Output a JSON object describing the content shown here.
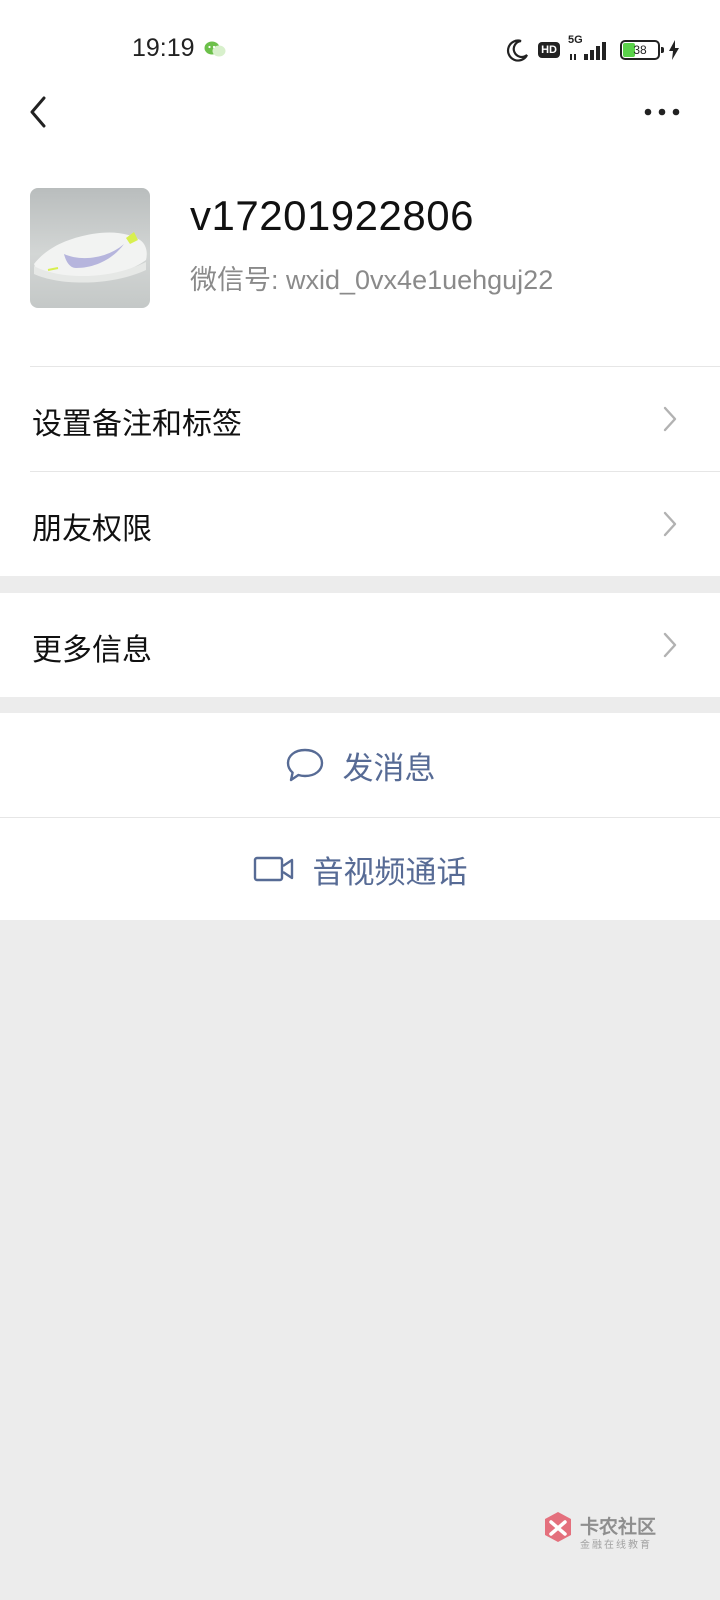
{
  "status_bar": {
    "time": "19:19",
    "network": "5G",
    "hd": "HD",
    "battery": "38"
  },
  "profile": {
    "nickname": "v17201922806",
    "wxid_line": "微信号: wxid_0vx4e1uehguj22"
  },
  "menu": {
    "remark_tags": "设置备注和标签",
    "friend_permissions": "朋友权限",
    "more_info": "更多信息"
  },
  "actions": {
    "send_message": "发消息",
    "av_call": "音视频通话"
  },
  "watermark": {
    "title": "卡农社区",
    "subtitle": "金融在线教育"
  },
  "colors": {
    "link_blue": "#576b95",
    "page_bg": "#ececec"
  }
}
